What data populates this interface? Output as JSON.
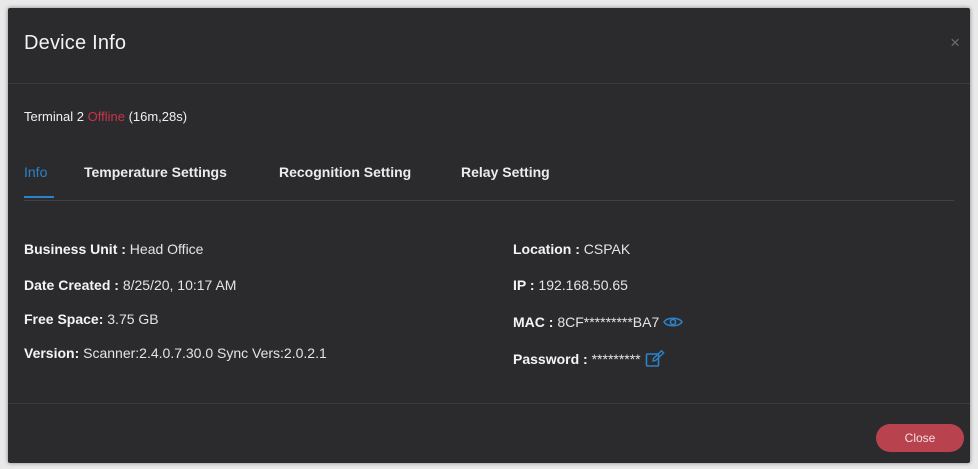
{
  "modal": {
    "title": "Device Info",
    "close_glyph": "×"
  },
  "status": {
    "device_name": "Terminal 2",
    "state": "Offline",
    "duration": "(16m,28s)"
  },
  "tabs": [
    {
      "label": "Info",
      "active": true
    },
    {
      "label": "Temperature Settings",
      "active": false
    },
    {
      "label": "Recognition Setting",
      "active": false
    },
    {
      "label": "Relay Setting",
      "active": false
    }
  ],
  "info": {
    "business_unit": {
      "label": "Business Unit :",
      "value": "Head Office"
    },
    "date_created": {
      "label": "Date Created :",
      "value": "8/25/20, 10:17 AM"
    },
    "free_space": {
      "label": "Free Space:",
      "value": "3.75 GB"
    },
    "version": {
      "label": "Version:",
      "value": "Scanner:2.4.0.7.30.0 Sync Vers:2.0.2.1"
    },
    "location": {
      "label": "Location :",
      "value": "CSPAK"
    },
    "ip": {
      "label": "IP :",
      "value": "192.168.50.65"
    },
    "mac": {
      "label": "MAC :",
      "value": "8CF*********BA7",
      "icon": "eye-icon"
    },
    "password": {
      "label": "Password :",
      "value": "*********",
      "icon": "edit-icon"
    }
  },
  "footer": {
    "close_label": "Close"
  },
  "colors": {
    "modal_bg": "#2b2b2d",
    "accent_blue": "#2c82c9",
    "offline_red": "#c7344a",
    "close_button": "#b8434f"
  }
}
